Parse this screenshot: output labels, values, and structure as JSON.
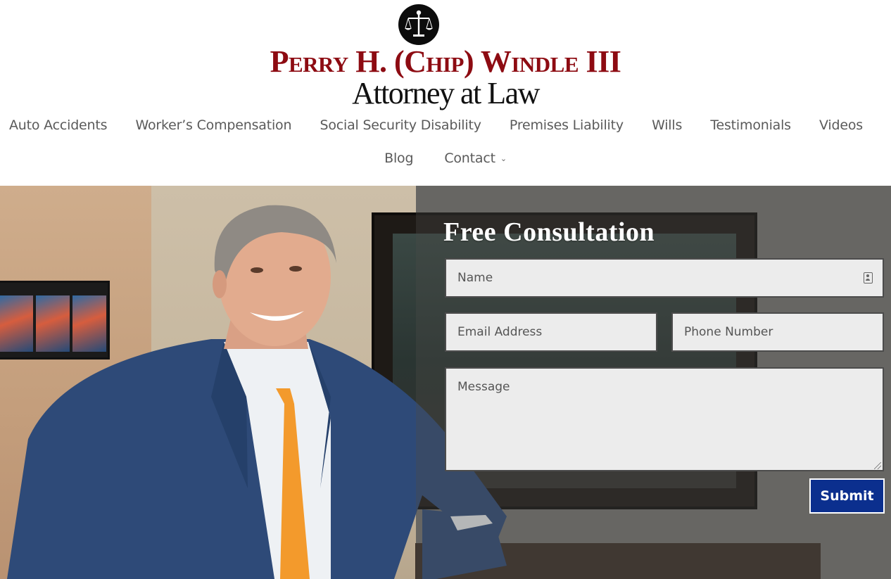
{
  "brand": {
    "name": "Perry H. (Chip) Windle III",
    "subtitle": "Attorney at Law",
    "emblem_icon": "scales-of-justice-icon",
    "name_color": "#8d0b12"
  },
  "nav": {
    "items": [
      {
        "label": "Auto Accidents"
      },
      {
        "label": "Worker’s Compensation"
      },
      {
        "label": "Social Security Disability"
      },
      {
        "label": "Premises Liability"
      },
      {
        "label": "Wills"
      },
      {
        "label": "Testimonials"
      },
      {
        "label": "Videos"
      },
      {
        "label": "Blog"
      },
      {
        "label": "Contact",
        "has_dropdown": true,
        "icon": "chevron-down-icon"
      }
    ]
  },
  "hero": {
    "image": "attorney-portrait-photo"
  },
  "form": {
    "title": "Free Consultation",
    "name_placeholder": "Name",
    "email_placeholder": "Email Address",
    "phone_placeholder": "Phone Number",
    "message_placeholder": "Message",
    "submit_label": "Submit",
    "submit_color": "#0b2f8e",
    "autofill_icon": "contact-card-icon"
  }
}
